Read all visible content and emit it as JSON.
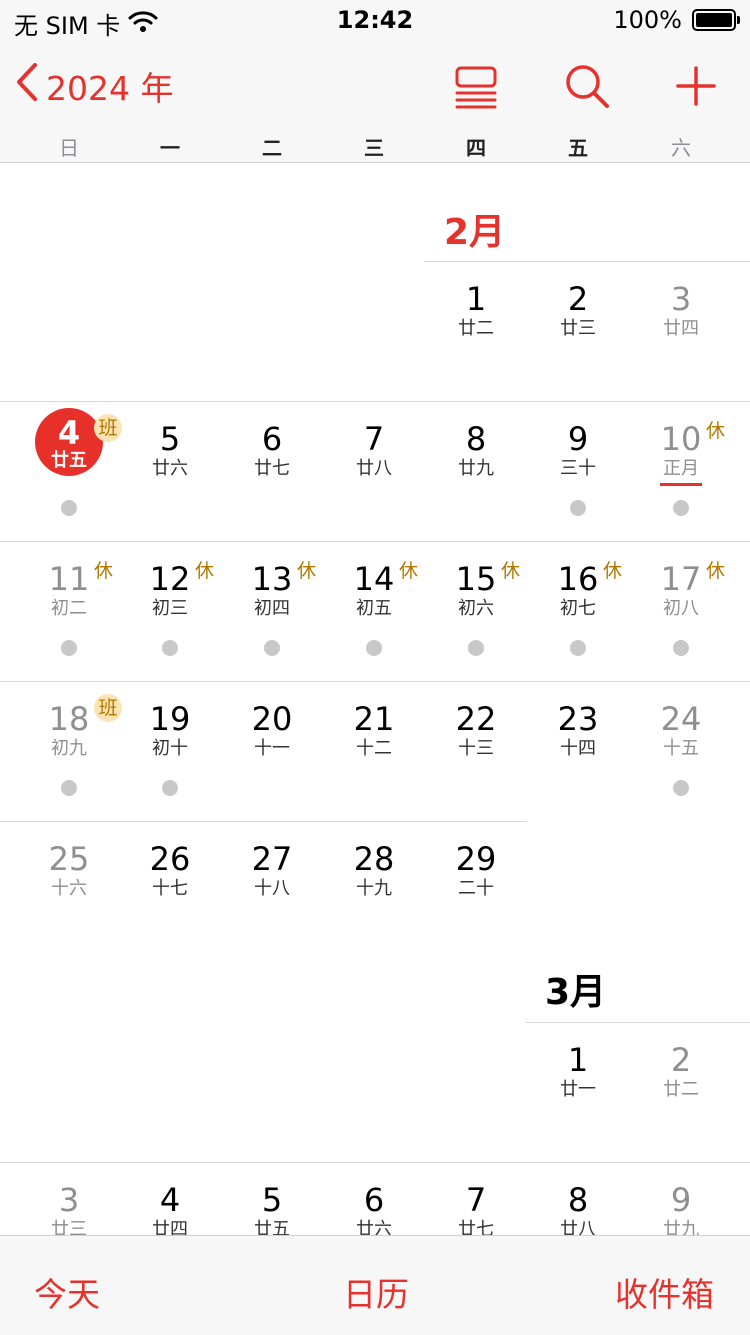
{
  "status_bar": {
    "carrier": "无 SIM 卡",
    "time": "12:42",
    "battery": "100%"
  },
  "nav": {
    "back_label": "2024 年"
  },
  "weekdays": [
    "日",
    "一",
    "二",
    "三",
    "四",
    "五",
    "六"
  ],
  "february": {
    "title": "2月",
    "weeks": [
      [
        null,
        null,
        null,
        null,
        {
          "d": "1",
          "l": "廿二"
        },
        {
          "d": "2",
          "l": "廿三"
        },
        {
          "d": "3",
          "l": "廿四"
        }
      ],
      [
        {
          "d": "4",
          "l": "廿五",
          "badge": "班",
          "dot": true,
          "today": true
        },
        {
          "d": "5",
          "l": "廿六"
        },
        {
          "d": "6",
          "l": "廿七"
        },
        {
          "d": "7",
          "l": "廿八"
        },
        {
          "d": "8",
          "l": "廿九"
        },
        {
          "d": "9",
          "l": "三十",
          "dot": true
        },
        {
          "d": "10",
          "l": "正月",
          "badge": "休",
          "dot": true,
          "underline": true
        }
      ],
      [
        {
          "d": "11",
          "l": "初二",
          "badge": "休",
          "dot": true
        },
        {
          "d": "12",
          "l": "初三",
          "badge": "休",
          "dot": true
        },
        {
          "d": "13",
          "l": "初四",
          "badge": "休",
          "dot": true
        },
        {
          "d": "14",
          "l": "初五",
          "badge": "休",
          "dot": true
        },
        {
          "d": "15",
          "l": "初六",
          "badge": "休",
          "dot": true
        },
        {
          "d": "16",
          "l": "初七",
          "badge": "休",
          "dot": true
        },
        {
          "d": "17",
          "l": "初八",
          "badge": "休",
          "dot": true
        }
      ],
      [
        {
          "d": "18",
          "l": "初九",
          "badge": "班",
          "dot": true
        },
        {
          "d": "19",
          "l": "初十",
          "dot": true
        },
        {
          "d": "20",
          "l": "十一"
        },
        {
          "d": "21",
          "l": "十二"
        },
        {
          "d": "22",
          "l": "十三"
        },
        {
          "d": "23",
          "l": "十四"
        },
        {
          "d": "24",
          "l": "十五",
          "dot": true
        }
      ],
      [
        {
          "d": "25",
          "l": "十六"
        },
        {
          "d": "26",
          "l": "十七"
        },
        {
          "d": "27",
          "l": "十八"
        },
        {
          "d": "28",
          "l": "十九"
        },
        {
          "d": "29",
          "l": "二十"
        },
        null,
        null
      ]
    ]
  },
  "march": {
    "title": "3月",
    "weeks": [
      [
        null,
        null,
        null,
        null,
        null,
        {
          "d": "1",
          "l": "廿一"
        },
        {
          "d": "2",
          "l": "廿二"
        }
      ],
      [
        {
          "d": "3",
          "l": "廿三"
        },
        {
          "d": "4",
          "l": "廿四"
        },
        {
          "d": "5",
          "l": "廿五"
        },
        {
          "d": "6",
          "l": "廿六"
        },
        {
          "d": "7",
          "l": "廿七"
        },
        {
          "d": "8",
          "l": "廿八"
        },
        {
          "d": "9",
          "l": "廿九"
        }
      ]
    ]
  },
  "tabbar": {
    "today": "今天",
    "calendars": "日历",
    "inbox": "收件箱"
  },
  "colors": {
    "accent": "#e5322d",
    "holiday_badge": "#b07800",
    "workday_badge_bg": "#fbe3b4"
  }
}
